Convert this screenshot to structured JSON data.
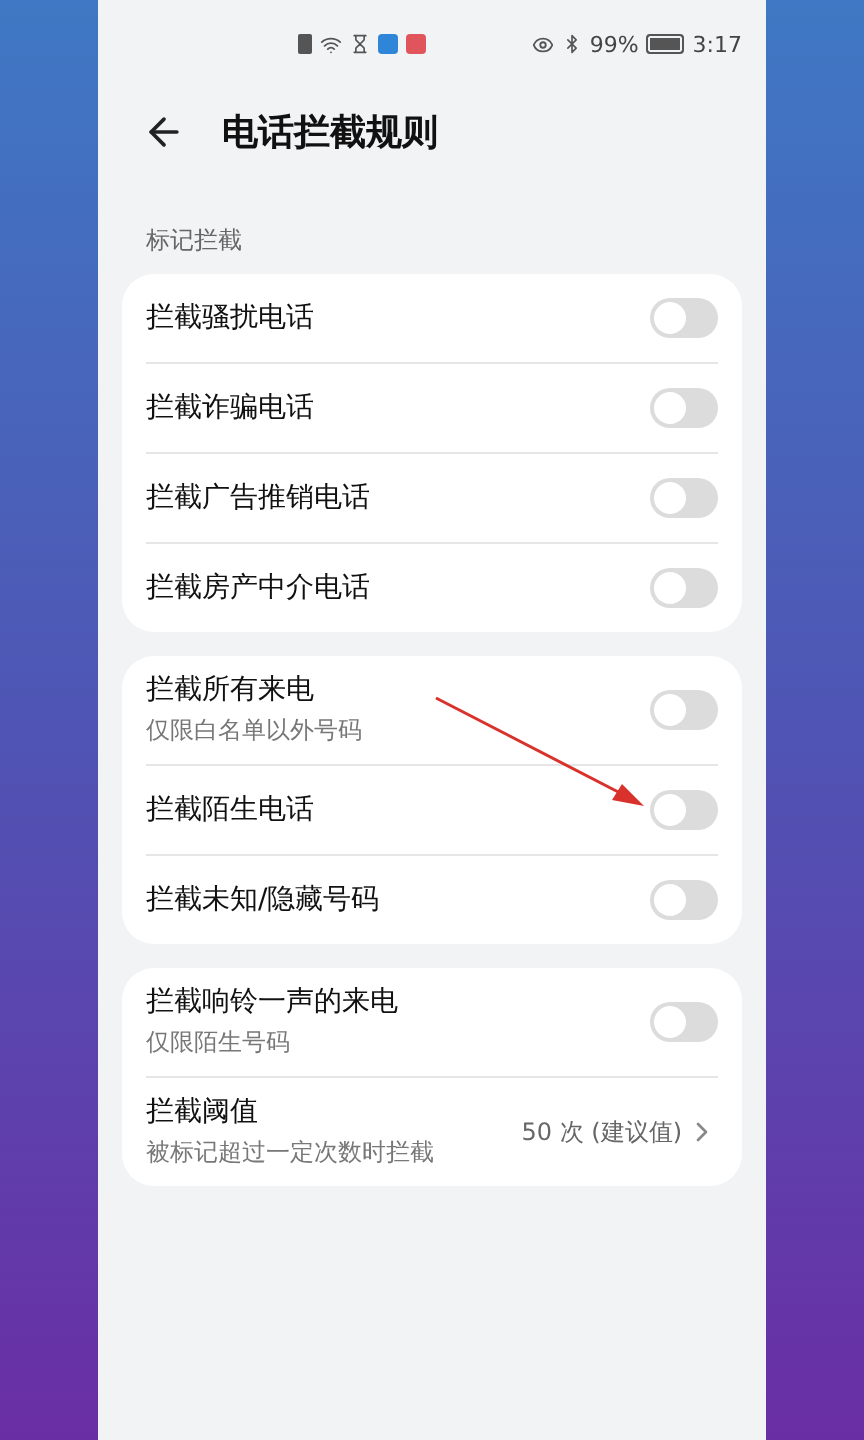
{
  "status_bar": {
    "battery": "99%",
    "time": "3:17"
  },
  "header": {
    "title": "电话拦截规则"
  },
  "sections": [
    {
      "label": "标记拦截",
      "items": [
        {
          "kind": "toggle",
          "title": "拦截骚扰电话",
          "on": false
        },
        {
          "kind": "toggle",
          "title": "拦截诈骗电话",
          "on": false
        },
        {
          "kind": "toggle",
          "title": "拦截广告推销电话",
          "on": false
        },
        {
          "kind": "toggle",
          "title": "拦截房产中介电话",
          "on": false
        }
      ]
    },
    {
      "items": [
        {
          "kind": "toggle",
          "title": "拦截所有来电",
          "subtitle": "仅限白名单以外号码",
          "on": false
        },
        {
          "kind": "toggle",
          "title": "拦截陌生电话",
          "on": false
        },
        {
          "kind": "toggle",
          "title": "拦截未知/隐藏号码",
          "on": false
        }
      ]
    },
    {
      "items": [
        {
          "kind": "toggle",
          "title": "拦截响铃一声的来电",
          "subtitle": "仅限陌生号码",
          "on": false
        },
        {
          "kind": "link",
          "title": "拦截阈值",
          "subtitle": "被标记超过一定次数时拦截",
          "value": "50 次 (建议值)"
        }
      ]
    }
  ]
}
